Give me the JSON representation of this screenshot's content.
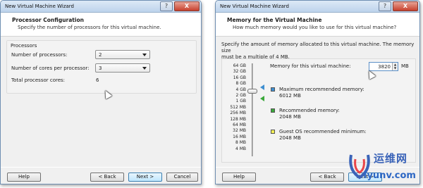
{
  "left_window": {
    "title": "New Virtual Machine Wizard",
    "help_glyph": "?",
    "close_glyph": "X",
    "header_title": "Processor Configuration",
    "header_subtitle": "Specify the number of processors for this virtual machine.",
    "group_label": "Processors",
    "num_processors_label": "Number of processors:",
    "num_processors_value": "2",
    "cores_label": "Number of cores per processor:",
    "cores_value": "3",
    "total_label": "Total processor cores:",
    "total_value": "6",
    "buttons": {
      "help": "Help",
      "back": "< Back",
      "next": "Next >",
      "cancel": "Cancel"
    }
  },
  "right_window": {
    "title": "New Virtual Machine Wizard",
    "help_glyph": "?",
    "close_glyph": "X",
    "header_title": "Memory for the Virtual Machine",
    "header_subtitle": "How much memory would you like to use for this virtual machine?",
    "description_line1": "Specify the amount of memory allocated to this virtual machine. The memory size",
    "description_line2": "must be a multiple of 4 MB.",
    "memory_label": "Memory for this virtual machine:",
    "memory_value": "3820",
    "memory_unit": "MB",
    "scale": [
      "64 GB",
      "32 GB",
      "16 GB",
      "8 GB",
      "4 GB",
      "2 GB",
      "1 GB",
      "512 MB",
      "256 MB",
      "128 MB",
      "64 MB",
      "32 MB",
      "16 MB",
      "8 MB",
      "4 MB"
    ],
    "max_label": "Maximum recommended memory:",
    "max_value": "6012 MB",
    "rec_label": "Recommended memory:",
    "rec_value": "2048 MB",
    "min_label": "Guest OS recommended minimum:",
    "min_value": "2048 MB",
    "buttons": {
      "help": "Help",
      "back": "< Back",
      "next": "Next >"
    }
  },
  "watermark": {
    "text_cn": "运维网",
    "url": "iyunv.com"
  },
  "colors": {
    "max_marker": "#3e8ed0",
    "rec_marker": "#3aa83a",
    "min_marker": "#f2ee54"
  }
}
